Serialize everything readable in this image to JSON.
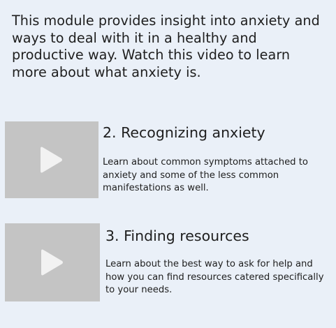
{
  "intro": {
    "text": "This module provides insight into anxiety and ways to deal with it in a healthy and productive way. Watch this video to learn more about what anxiety is."
  },
  "modules": [
    {
      "title": "2. Recognizing anxiety",
      "description": "Learn about common symptoms attached to anxiety and some of the less common manifestations as well.",
      "icon": "play-icon"
    },
    {
      "title": "3. Finding resources",
      "description": "Learn about the best way to ask for help and how you can find resources catered specifically to your needs.",
      "icon": "play-icon"
    }
  ],
  "colors": {
    "background": "#EAF0F8",
    "thumbnail": "#C4C4C4",
    "play_icon": "#F2F2F2",
    "text": "#1E1E1E"
  }
}
